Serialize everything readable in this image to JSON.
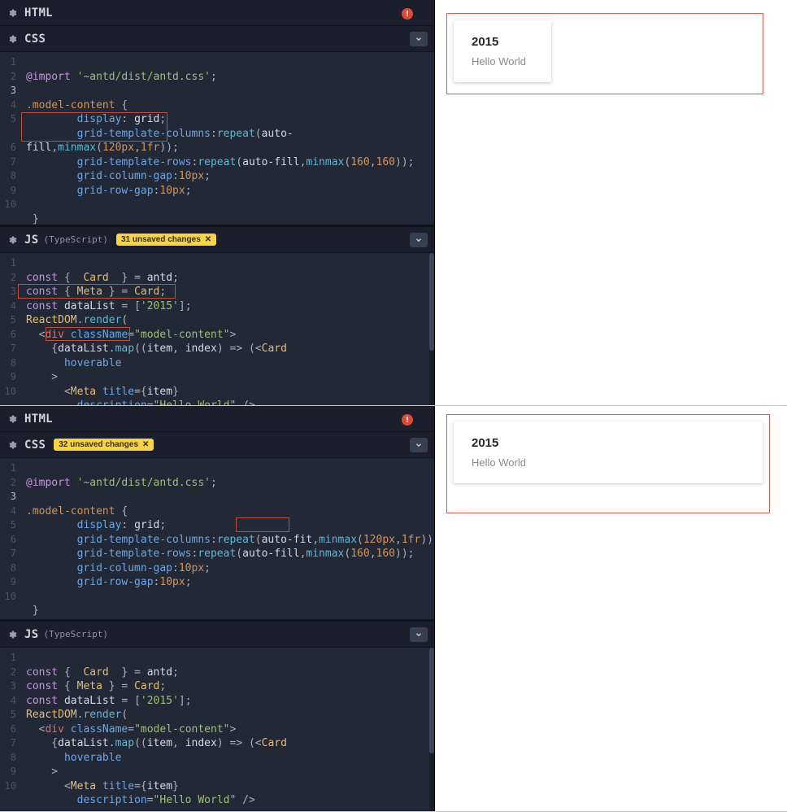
{
  "panels": {
    "html_label": "HTML",
    "css_label": "CSS",
    "js_label": "JS",
    "js_sub": "(TypeScript)"
  },
  "badges": {
    "top_css_unsaved": "32 unsaved changes",
    "js_unsaved": "31 unsaved changes",
    "close_glyph": "✕"
  },
  "warn_glyph": "!",
  "preview": {
    "card_title": "2015",
    "card_desc": "Hello World"
  },
  "code": {
    "css_top": {
      "lines": [
        "1",
        "2",
        "3",
        "4",
        "5",
        "6",
        "7",
        "8",
        "9",
        "10"
      ],
      "l1a": "@import",
      "l1b": "'~antd/dist/antd.css'",
      "l1c": ";",
      "l2": "",
      "l3a": ".model-content",
      "l3b": " {",
      "l4a": "        display",
      "l4b": ": ",
      "l4c": "grid",
      "l4d": ";",
      "l5a": "        grid-template-columns",
      "l5b": ":",
      "l5c": "repeat",
      "l5d": "(",
      "l5e": "auto-",
      "l5f": "fill",
      "l5g": ",",
      "l5h": "minmax",
      "l5i": "(",
      "l5j": "120px",
      "l5k": ",",
      "l5l": "1fr",
      "l5m": "));",
      "l6a": "        grid-template-rows",
      "l6b": ":",
      "l6c": "repeat",
      "l6d": "(",
      "l6e": "auto-fill",
      "l6f": ",",
      "l6g": "minmax",
      "l6h": "(",
      "l6i": "160",
      "l6j": ",",
      "l6k": "160",
      "l6l": "));",
      "l7a": "        grid-column-gap",
      "l7b": ":",
      "l7c": "10px",
      "l7d": ";",
      "l8a": "        grid-row-gap",
      "l8b": ":",
      "l8c": "10px",
      "l8d": ";",
      "l9": "",
      "l10": " }"
    },
    "css_bot": {
      "lines": [
        "1",
        "2",
        "3",
        "4",
        "5",
        "6",
        "7",
        "8",
        "9",
        "10"
      ],
      "l1a": "@import",
      "l1b": "'~antd/dist/antd.css'",
      "l1c": ";",
      "l2": "",
      "l3a": ".model-content",
      "l3b": " {",
      "l4a": "        display",
      "l4b": ": ",
      "l4c": "grid",
      "l4d": ";",
      "l5a": "        grid-template-columns",
      "l5b": ":",
      "l5c": "repeat",
      "l5d": "(",
      "l5e": "auto-fit",
      "l5f": ",",
      "l5g": "minmax",
      "l5h": "(",
      "l5i": "120px",
      "l5j": ",",
      "l5k": "1fr",
      "l5l": "));",
      "l6a": "        grid-template-rows",
      "l6b": ":",
      "l6c": "repeat",
      "l6d": "(",
      "l6e": "auto-fill",
      "l6f": ",",
      "l6g": "minmax",
      "l6h": "(",
      "l6i": "160",
      "l6j": ",",
      "l6k": "160",
      "l6l": "));",
      "l7a": "        grid-column-gap",
      "l7b": ":",
      "l7c": "10px",
      "l7d": ";",
      "l8a": "        grid-row-gap",
      "l8b": ":",
      "l8c": "10px",
      "l8d": ";",
      "l9": "",
      "l10": " }"
    },
    "js": {
      "lines": [
        "1",
        "2",
        "3",
        "4",
        "5",
        "6",
        "7",
        "8",
        "9",
        "10"
      ],
      "l1a": "const",
      "l1b": " {  ",
      "l1c": "Card",
      "l1d": "  } = ",
      "l1e": "antd",
      "l1f": ";",
      "l2a": "const",
      "l2b": " { ",
      "l2c": "Meta",
      "l2d": " } = ",
      "l2e": "Card",
      "l2f": ";",
      "l3a": "const",
      "l3b": " ",
      "l3c": "dataList",
      "l3d": " = [",
      "l3e": "'2015'",
      "l3f": "];",
      "l4a": "ReactDOM",
      "l4b": ".",
      "l4c": "render",
      "l4d": "(",
      "l5a": "  <",
      "l5b": "div",
      "l5c": " ",
      "l5d": "className",
      "l5e": "=",
      "l5f": "\"model-content\"",
      "l5g": ">",
      "l6a": "    {",
      "l6b": "dataList",
      "l6c": ".",
      "l6d": "map",
      "l6e": "((",
      "l6f": "item",
      "l6g": ", ",
      "l6h": "index",
      "l6i": ") => (<",
      "l6j": "Card",
      "l7a": "      hoverable",
      "l8a": "    >",
      "l9a": "      <",
      "l9b": "Meta",
      "l9c": " ",
      "l9d": "title",
      "l9e": "={",
      "l9f": "item",
      "l9g": "}",
      "l10a": "        ",
      "l10b": "description",
      "l10c": "=",
      "l10d": "\"Hello World\"",
      "l10e": " />"
    }
  }
}
